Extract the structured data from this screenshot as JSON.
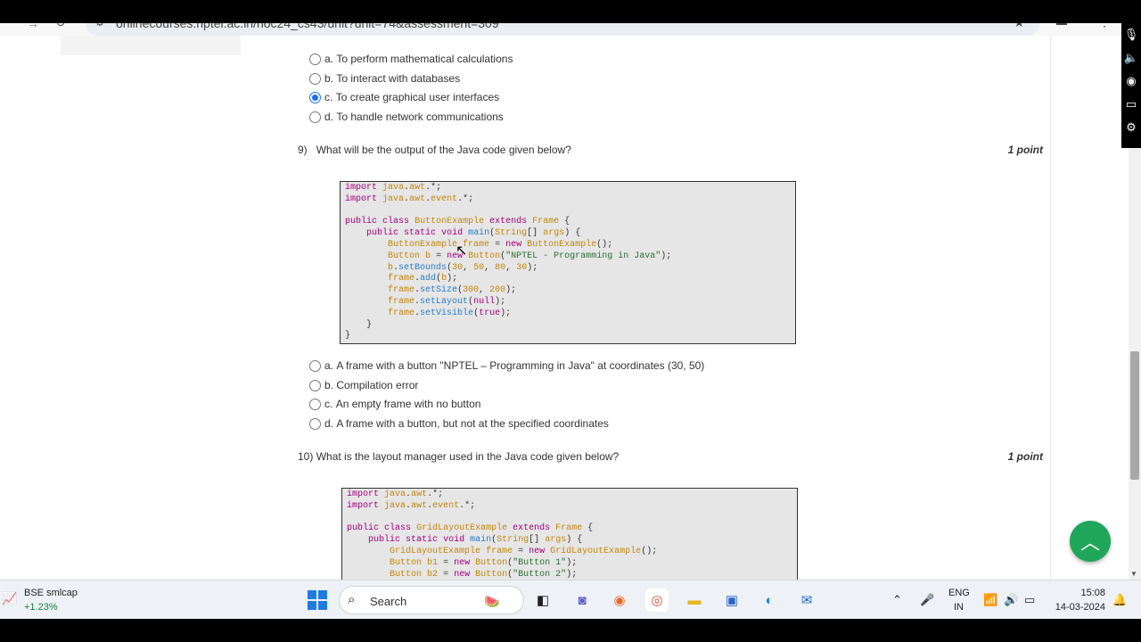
{
  "browser": {
    "url": "onlinecourses.nptel.ac.in/noc24_cs43/unit?unit=74&assessment=309"
  },
  "q8_options": [
    {
      "letter": "a.",
      "text": "To perform mathematical calculations",
      "checked": false
    },
    {
      "letter": "b.",
      "text": "To interact with databases",
      "checked": false
    },
    {
      "letter": "c.",
      "text": "To create graphical user interfaces",
      "checked": true
    },
    {
      "letter": "d.",
      "text": "To handle network communications",
      "checked": false
    }
  ],
  "q9": {
    "number": "9)",
    "text": "What will be the output of the Java code given below?",
    "points": "1 point",
    "code": [
      "import java.awt.*;",
      "import java.awt.event.*;",
      "",
      "public class ButtonExample extends Frame {",
      "    public static void main(String[] args) {",
      "        ButtonExample frame = new ButtonExample();",
      "        Button b = new Button(\"NPTEL - Programming in Java\");",
      "        b.setBounds(30, 50, 80, 30);",
      "        frame.add(b);",
      "        frame.setSize(300, 200);",
      "        frame.setLayout(null);",
      "        frame.setVisible(true);",
      "    }",
      "}"
    ],
    "options": [
      {
        "letter": "a.",
        "text": "A frame with a button \"NPTEL – Programming in Java\" at coordinates (30, 50)"
      },
      {
        "letter": "b.",
        "text": "Compilation error"
      },
      {
        "letter": "c.",
        "text": "An empty frame with no button"
      },
      {
        "letter": "d.",
        "text": "A frame with a button, but not at the specified coordinates"
      }
    ]
  },
  "q10": {
    "number": "10)",
    "text": "What is the layout manager used in the Java code given below?",
    "points": "1 point",
    "code": [
      "import java.awt.*;",
      "import java.awt.event.*;",
      "",
      "public class GridLayoutExample extends Frame {",
      "    public static void main(String[] args) {",
      "        GridLayoutExample frame = new GridLayoutExample();",
      "        Button b1 = new Button(\"Button 1\");",
      "        Button b2 = new Button(\"Button 2\");"
    ]
  },
  "taskbar": {
    "stock_name": "BSE smlcap",
    "stock_change": "+1.23%",
    "search_label": "Search",
    "lang_line1": "ENG",
    "lang_line2": "IN",
    "time": "15:08",
    "date": "14-03-2024"
  },
  "colors": {
    "accent": "#1a73e8",
    "fab": "#1fa65a",
    "code_bg": "#e6e6e6"
  }
}
